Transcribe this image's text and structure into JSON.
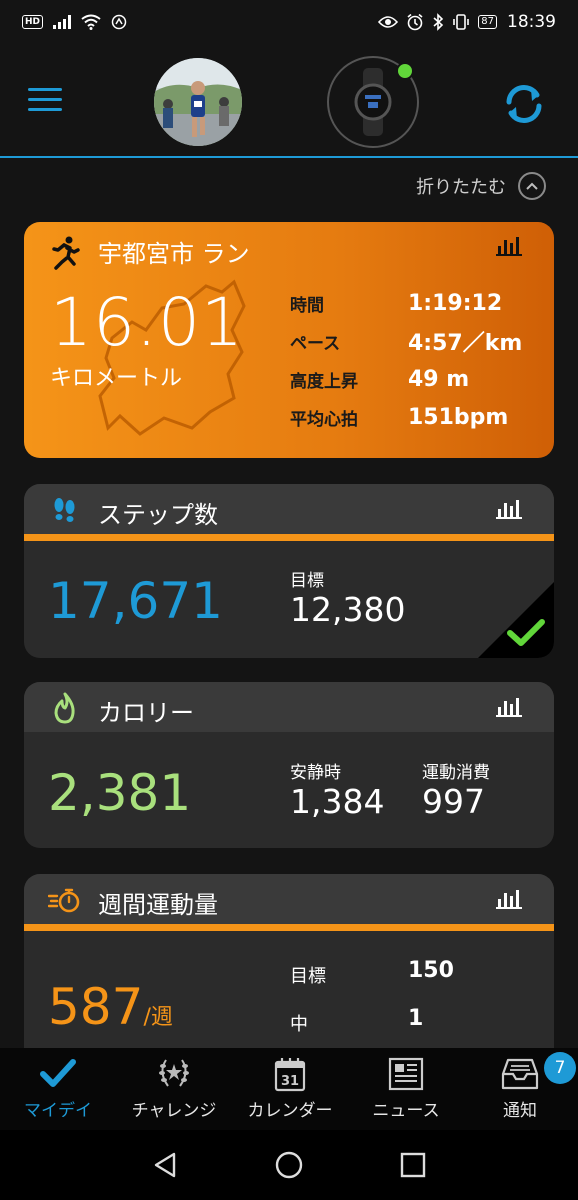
{
  "status_bar": {
    "hd": "HD",
    "battery": "87",
    "time": "18:39"
  },
  "header": {
    "avatar": "runner-photo",
    "device": "garmin-watch"
  },
  "collapse_label": "折りたたむ",
  "run_card": {
    "title": "宇都宮市 ラン",
    "distance": "16.01",
    "distance_unit": "キロメートル",
    "stats": [
      {
        "label": "時間",
        "value": "1:19:12"
      },
      {
        "label": "ペース",
        "value": "4:57／km"
      },
      {
        "label": "高度上昇",
        "value": "49 m"
      },
      {
        "label": "平均心拍",
        "value": "151bpm"
      }
    ]
  },
  "steps_card": {
    "title": "ステップ数",
    "value": "17,671",
    "goal_label": "目標",
    "goal_value": "12,380",
    "goal_met": true
  },
  "calories_card": {
    "title": "カロリー",
    "value": "2,381",
    "rest_label": "安静時",
    "rest_value": "1,384",
    "active_label": "運動消費",
    "active_value": "997"
  },
  "weekly_card": {
    "title": "週間運動量",
    "value": "587",
    "per": "/週",
    "goal_label": "目標",
    "goal_value": "150",
    "mid_label": "中",
    "mid_value": "1"
  },
  "bottom_nav": {
    "items": [
      {
        "label": "マイデイ",
        "icon": "check-icon"
      },
      {
        "label": "チャレンジ",
        "icon": "laurel-icon"
      },
      {
        "label": "カレンダー",
        "icon": "calendar-icon"
      },
      {
        "label": "ニュース",
        "icon": "news-icon"
      },
      {
        "label": "通知",
        "icon": "inbox-icon"
      }
    ],
    "calendar_day": "31",
    "notification_count": "7"
  },
  "colors": {
    "accent": "#1e9ad6",
    "run_orange": "#f59418",
    "calories_green": "#a9e07d",
    "goal_check": "#61d63a"
  }
}
